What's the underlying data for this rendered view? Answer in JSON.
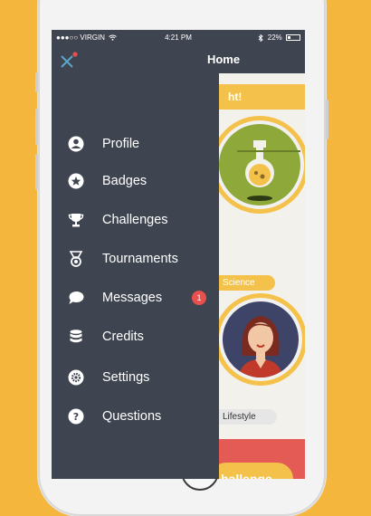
{
  "status_bar": {
    "carrier": "●●●○○ VIRGIN",
    "time": "4:21 PM",
    "battery": "22%",
    "battery_level": 0.22
  },
  "header": {
    "title": "Home",
    "close_icon": "close-x-icon"
  },
  "menu": {
    "items": [
      {
        "label": "Profile",
        "icon": "user-icon"
      },
      {
        "label": "Badges",
        "icon": "star-badge-icon"
      },
      {
        "label": "Challenges",
        "icon": "trophy-icon"
      },
      {
        "label": "Tournaments",
        "icon": "medal-icon"
      },
      {
        "label": "Messages",
        "icon": "chat-bubble-icon",
        "badge": "1"
      },
      {
        "label": "Credits",
        "icon": "coins-icon"
      },
      {
        "label": "Settings",
        "icon": "gear-icon"
      },
      {
        "label": "Questions",
        "icon": "question-icon"
      }
    ]
  },
  "background": {
    "banner_text": "ht!",
    "science_label": "Science",
    "lifestyle_label": "Lifestyle",
    "cta_label": "hallenge"
  },
  "colors": {
    "page_bg": "#f4b63c",
    "drawer_bg": "#3f4550",
    "accent_yellow": "#f4c24a",
    "badge_red": "#e8504d",
    "close_icon_blue": "#5aa6c8"
  }
}
